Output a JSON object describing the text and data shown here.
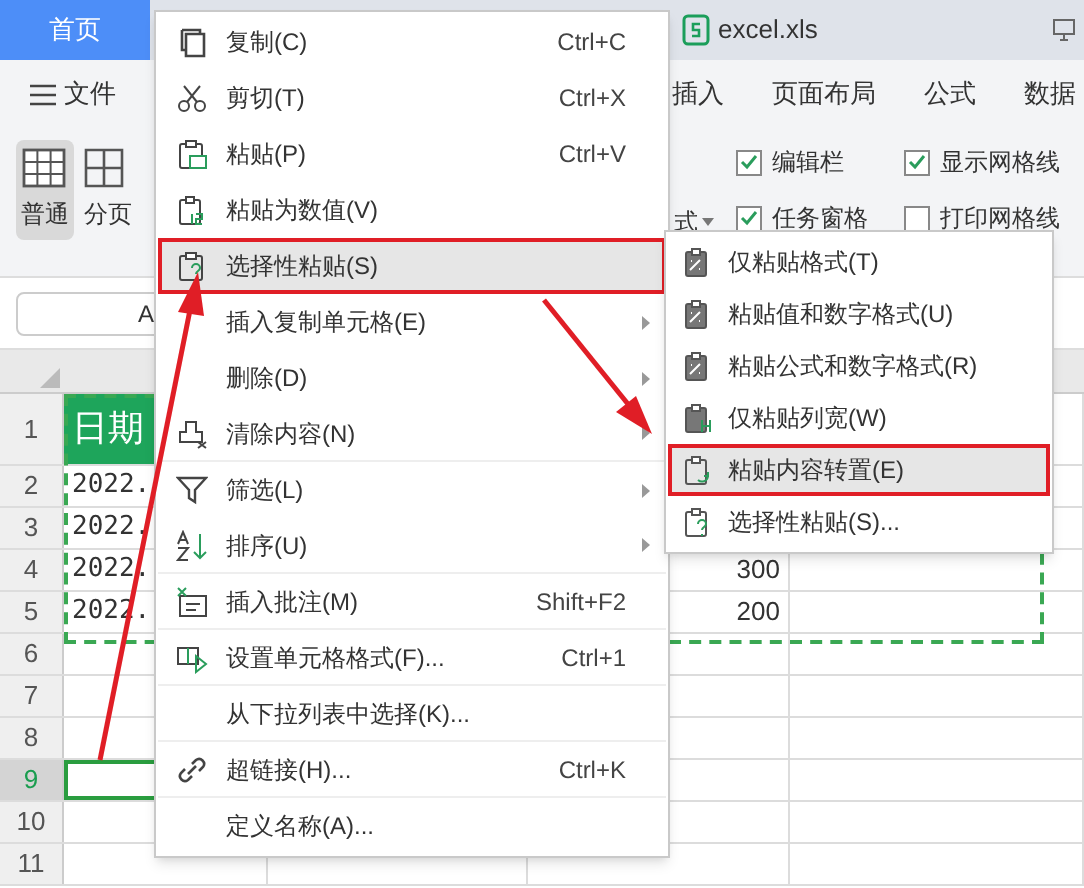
{
  "tabs": [
    {
      "label": "首页",
      "selected": true
    },
    {
      "label": "excel.xls",
      "selected": false
    }
  ],
  "menu_bar": [
    {
      "label": "文件"
    },
    {
      "label": "插入"
    },
    {
      "label": "页面布局"
    },
    {
      "label": "公式"
    },
    {
      "label": "数据"
    }
  ],
  "toolbar": {
    "views": [
      {
        "label": "普通",
        "selected": true
      },
      {
        "label": "分页",
        "selected": false
      }
    ],
    "partial_label": "式",
    "checkboxes": [
      {
        "label": "编辑栏",
        "checked": true
      },
      {
        "label": "显示网格线",
        "checked": true
      },
      {
        "label": "任务窗格",
        "checked": true
      },
      {
        "label": "打印网格线",
        "checked": false
      }
    ]
  },
  "name_box": "A",
  "sheet": {
    "row_headers": [
      {
        "label": "1",
        "selected": false
      },
      {
        "label": "2",
        "selected": false
      },
      {
        "label": "3",
        "selected": false
      },
      {
        "label": "4",
        "selected": false
      },
      {
        "label": "5",
        "selected": false
      },
      {
        "label": "6",
        "selected": false
      },
      {
        "label": "7",
        "selected": false
      },
      {
        "label": "8",
        "selected": false
      },
      {
        "label": "9",
        "selected": true
      },
      {
        "label": "10",
        "selected": false
      },
      {
        "label": "11",
        "selected": false
      }
    ],
    "rows": [
      [
        "日期",
        "",
        "",
        ""
      ],
      [
        "2022.",
        "",
        "",
        ""
      ],
      [
        "2022.",
        "",
        "",
        ""
      ],
      [
        "2022.",
        "",
        "300",
        ""
      ],
      [
        "2022.",
        "",
        "200",
        ""
      ]
    ]
  },
  "context_menu": [
    {
      "label": "复制(C)",
      "shortcut": "Ctrl+C",
      "submenu": false,
      "highlighted": false,
      "divider_after": false
    },
    {
      "label": "剪切(T)",
      "shortcut": "Ctrl+X",
      "submenu": false,
      "highlighted": false,
      "divider_after": false
    },
    {
      "label": "粘贴(P)",
      "shortcut": "Ctrl+V",
      "submenu": false,
      "highlighted": false,
      "divider_after": false
    },
    {
      "label": "粘贴为数值(V)",
      "submenu": false,
      "highlighted": false,
      "divider_after": false
    },
    {
      "label": "选择性粘贴(S)",
      "submenu": false,
      "highlighted": true,
      "divider_after": true
    },
    {
      "label": "插入复制单元格(E)",
      "submenu": true,
      "highlighted": false,
      "divider_after": false
    },
    {
      "label": "删除(D)",
      "submenu": true,
      "highlighted": false,
      "divider_after": false
    },
    {
      "label": "清除内容(N)",
      "submenu": true,
      "highlighted": false,
      "divider_after": true
    },
    {
      "label": "筛选(L)",
      "submenu": true,
      "highlighted": false,
      "divider_after": false
    },
    {
      "label": "排序(U)",
      "submenu": true,
      "highlighted": false,
      "divider_after": true
    },
    {
      "label": "插入批注(M)",
      "shortcut": "Shift+F2",
      "submenu": false,
      "highlighted": false,
      "divider_after": true
    },
    {
      "label": "设置单元格格式(F)...",
      "shortcut": "Ctrl+1",
      "submenu": false,
      "highlighted": false,
      "divider_after": true
    },
    {
      "label": "从下拉列表中选择(K)...",
      "submenu": false,
      "highlighted": false,
      "divider_after": true
    },
    {
      "label": "超链接(H)...",
      "shortcut": "Ctrl+K",
      "submenu": false,
      "highlighted": false,
      "divider_after": true
    },
    {
      "label": "定义名称(A)...",
      "submenu": false,
      "highlighted": false,
      "divider_after": false
    }
  ],
  "submenu": [
    {
      "label": "仅粘贴格式(T)",
      "highlighted": false
    },
    {
      "label": "粘贴值和数字格式(U)",
      "highlighted": false
    },
    {
      "label": "粘贴公式和数字格式(R)",
      "highlighted": false
    },
    {
      "label": "仅粘贴列宽(W)",
      "highlighted": false
    },
    {
      "label": "粘贴内容转置(E)",
      "highlighted": true
    },
    {
      "label": "选择性粘贴(S)...",
      "highlighted": false
    }
  ]
}
